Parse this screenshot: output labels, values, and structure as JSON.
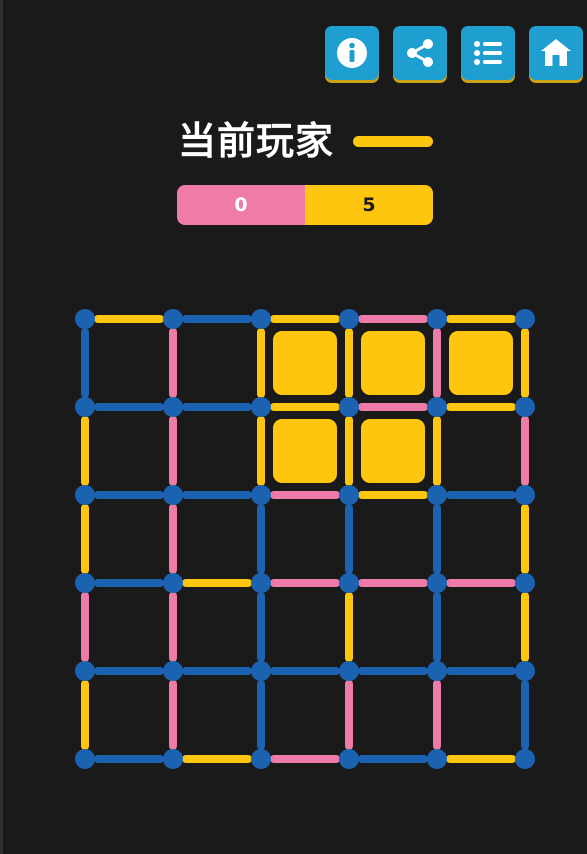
{
  "toolbar": {
    "buttons": [
      {
        "id": "info",
        "icon": "info-icon"
      },
      {
        "id": "share",
        "icon": "share-icon"
      },
      {
        "id": "list",
        "icon": "list-icon"
      },
      {
        "id": "home",
        "icon": "home-icon"
      }
    ]
  },
  "header": {
    "title": "当前玩家",
    "current_player_color": "#ffc60f"
  },
  "scores": {
    "player1": {
      "score": "0",
      "color": "#ef7ba8"
    },
    "player2": {
      "score": "5",
      "color": "#ffc60f"
    }
  },
  "colors": {
    "background": "#1a1a1a",
    "dot": "#1b63b0",
    "blue_line": "#1b63b0",
    "pink_line": "#ef7ba8",
    "yellow_line": "#ffc60f",
    "box_fill": "#ffc60f",
    "button": "#1e9fcf"
  },
  "board": {
    "rows": 5,
    "cols": 5,
    "horizontal_edges": [
      [
        "yellow",
        "blue",
        "yellow",
        "pink",
        "yellow"
      ],
      [
        "blue",
        "blue",
        "yellow",
        "pink",
        "yellow"
      ],
      [
        "blue",
        "blue",
        "pink",
        "yellow",
        "blue"
      ],
      [
        "blue",
        "yellow",
        "pink",
        "pink",
        "pink"
      ],
      [
        "blue",
        "blue",
        "blue",
        "blue",
        "blue"
      ],
      [
        "blue",
        "yellow",
        "pink",
        "blue",
        "yellow"
      ]
    ],
    "vertical_edges": [
      [
        "blue",
        "pink",
        "yellow",
        "yellow",
        "pink",
        "yellow"
      ],
      [
        "yellow",
        "pink",
        "yellow",
        "yellow",
        "yellow",
        "pink"
      ],
      [
        "yellow",
        "pink",
        "blue",
        "blue",
        "blue",
        "yellow"
      ],
      [
        "pink",
        "pink",
        "blue",
        "yellow",
        "blue",
        "yellow"
      ],
      [
        "yellow",
        "pink",
        "blue",
        "pink",
        "pink",
        "blue"
      ]
    ],
    "claimed_boxes": [
      {
        "row": 0,
        "col": 2,
        "owner": "yellow"
      },
      {
        "row": 0,
        "col": 3,
        "owner": "yellow"
      },
      {
        "row": 0,
        "col": 4,
        "owner": "yellow"
      },
      {
        "row": 1,
        "col": 2,
        "owner": "yellow"
      },
      {
        "row": 1,
        "col": 3,
        "owner": "yellow"
      }
    ]
  }
}
